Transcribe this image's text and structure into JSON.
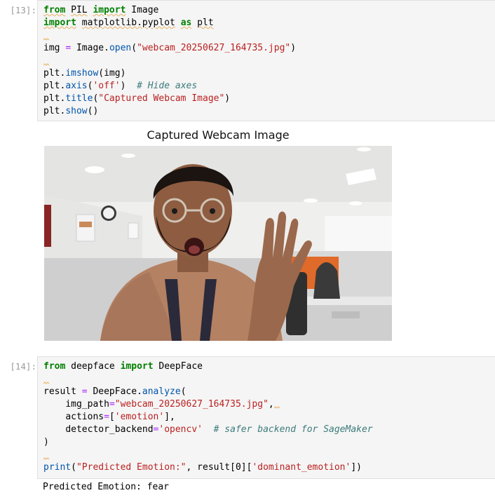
{
  "cell1": {
    "prompt": "[13]:",
    "lines": {
      "l1": {
        "kw1": "from",
        "mod": "PIL",
        "kw2": "import",
        "name": "Image"
      },
      "l2": {
        "kw1": "import",
        "mod": "matplotlib.pyplot",
        "kw2": "as",
        "name": "plt"
      },
      "l3": {
        "var": "img",
        "eq": "=",
        "obj": "Image.",
        "fn": "open",
        "open": "(",
        "str": "\"webcam_20250627_164735.jpg\"",
        "close": ")"
      },
      "l4": {
        "obj": "plt.",
        "fn": "imshow",
        "args": "(img)"
      },
      "l5": {
        "obj": "plt.",
        "fn": "axis",
        "open": "(",
        "str": "'off'",
        "close": ")",
        "comment": "# Hide axes"
      },
      "l6": {
        "obj": "plt.",
        "fn": "title",
        "open": "(",
        "str": "\"Captured Webcam Image\"",
        "close": ")"
      },
      "l7": {
        "obj": "plt.",
        "fn": "show",
        "args": "()"
      }
    }
  },
  "figure": {
    "title": "Captured Webcam Image",
    "image_alt": "person-surprised-webcam-photo"
  },
  "cell2": {
    "prompt": "[14]:",
    "lines": {
      "l1": {
        "kw1": "from",
        "mod": "deepface",
        "kw2": "import",
        "name": "DeepFace"
      },
      "l2": {
        "var": "result",
        "eq": "=",
        "obj": "DeepFace.",
        "fn": "analyze",
        "open": "("
      },
      "l3": {
        "param": "img_path",
        "eq": "=",
        "str": "\"webcam_20250627_164735.jpg\"",
        "comma": ","
      },
      "l4": {
        "param": "actions",
        "eq": "=",
        "open": "[",
        "str": "'emotion'",
        "close": "],"
      },
      "l5": {
        "param": "detector_backend",
        "eq": "=",
        "str": "'opencv'",
        "comment": "# safer backend for SageMaker"
      },
      "l6": {
        "close": ")"
      },
      "l7": {
        "fn": "print",
        "open": "(",
        "str1": "\"Predicted Emotion:\"",
        "mid": ", result",
        "idx_open": "[",
        "idx": "0",
        "idx_close": "][",
        "str2": "'dominant_emotion'",
        "close": "])"
      }
    }
  },
  "output": {
    "text": "Predicted Emotion: fear"
  },
  "colors": {
    "keyword": "#008000",
    "string": "#ba2121",
    "function": "#0055aa",
    "comment": "#3d7b7b",
    "cell_bg": "#f5f5f5"
  }
}
